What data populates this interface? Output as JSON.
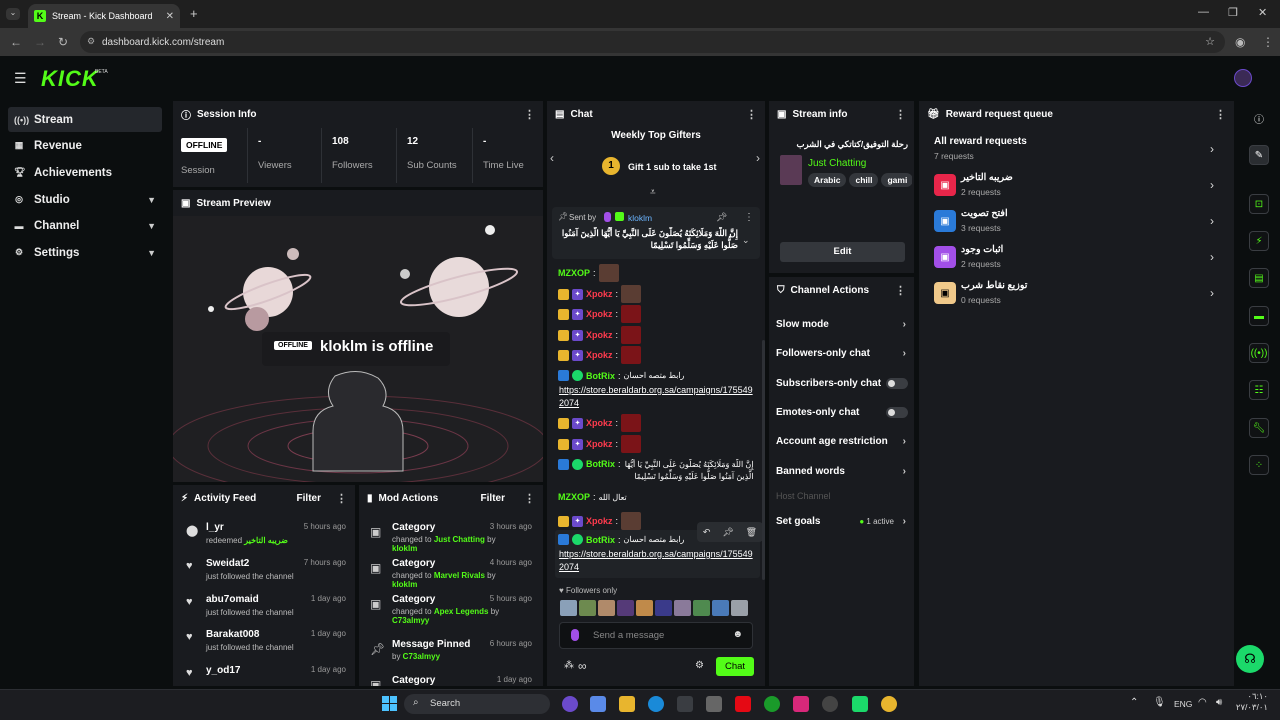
{
  "browser": {
    "tab_title": "Stream - Kick Dashboard",
    "url": "dashboard.kick.com/stream",
    "new_tab": "+"
  },
  "header": {
    "logo": "KICK",
    "beta": "BETA"
  },
  "sidebar": {
    "items": [
      {
        "label": "Stream",
        "icon": "broadcast-icon"
      },
      {
        "label": "Revenue",
        "icon": "revenue-icon"
      },
      {
        "label": "Achievements",
        "icon": "trophy-icon"
      },
      {
        "label": "Studio",
        "icon": "studio-icon"
      },
      {
        "label": "Channel",
        "icon": "channel-icon"
      },
      {
        "label": "Settings",
        "icon": "gear-icon"
      }
    ]
  },
  "session": {
    "title": "Session Info",
    "status": "OFFLINE",
    "status_label": "Session",
    "stats": [
      {
        "value": "-",
        "label": "Viewers"
      },
      {
        "value": "108",
        "label": "Followers"
      },
      {
        "value": "12",
        "label": "Sub Counts"
      },
      {
        "value": "-",
        "label": "Time Live"
      }
    ]
  },
  "preview": {
    "title": "Stream Preview",
    "badge": "OFFLINE",
    "message": "kloklm is offline"
  },
  "activity": {
    "title": "Activity Feed",
    "filter": "Filter",
    "items": [
      {
        "name": "l_yr",
        "desc_prefix": "redeemed ",
        "desc_highlight": "ضريبه التاخير",
        "time": "5 hours ago"
      },
      {
        "name": "Sweidat2",
        "desc_prefix": "just followed the channel",
        "desc_highlight": "",
        "time": "7 hours ago"
      },
      {
        "name": "abu7omaid",
        "desc_prefix": "just followed the channel",
        "desc_highlight": "",
        "time": "1 day ago"
      },
      {
        "name": "Barakat008",
        "desc_prefix": "just followed the channel",
        "desc_highlight": "",
        "time": "1 day ago"
      },
      {
        "name": "y_od17",
        "desc_prefix": "",
        "desc_highlight": "",
        "time": "1 day ago"
      }
    ]
  },
  "mod": {
    "title": "Mod Actions",
    "filter": "Filter",
    "items": [
      {
        "name": "Category",
        "pre": "changed to ",
        "hl1": "Just Chatting",
        "mid": " by ",
        "hl2": "kloklm",
        "time": "3 hours ago"
      },
      {
        "name": "Category",
        "pre": "changed to ",
        "hl1": "Marvel Rivals",
        "mid": " by ",
        "hl2": "kloklm",
        "time": "4 hours ago"
      },
      {
        "name": "Category",
        "pre": "changed to ",
        "hl1": "Apex Legends",
        "mid": " by ",
        "hl2": "C73almyy",
        "time": "5 hours ago"
      },
      {
        "name": "Message Pinned",
        "pre": "by ",
        "hl1": "C73almyy",
        "mid": "",
        "hl2": "",
        "time": "6 hours ago"
      },
      {
        "name": "Category",
        "pre": "",
        "hl1": "",
        "mid": "",
        "hl2": "",
        "time": "1 day ago"
      }
    ]
  },
  "chat": {
    "title": "Chat",
    "gifters_title": "Weekly Top Gifters",
    "gifters_rank": "1",
    "gifters_cta": "Gift 1 sub to take 1st",
    "pinned_sent_by": "Sent by",
    "pinned_user": "kloklm",
    "pinned_text": "إِنَّ اللَّهَ وَمَلَائِكَتَهُ يُصَلُّونَ عَلَى النَّبِيِّ يَا أَيُّهَا الَّذِينَ آمَنُوا صَلُّوا عَلَيْهِ وَسَلِّمُوا تَسْلِيمًا",
    "messages": [
      {
        "user": "MZXOP",
        "text": ""
      },
      {
        "user": "Xpokz",
        "text": ""
      },
      {
        "user": "Xpokz",
        "text": ""
      },
      {
        "user": "Xpokz",
        "text": ""
      },
      {
        "user": "Xpokz",
        "text": ""
      },
      {
        "user": "BotRix",
        "text": "رابط متصه احسان",
        "link": "https://store.beraldarb.org.sa/campaigns/1755492074"
      },
      {
        "user": "Xpokz",
        "text": ""
      },
      {
        "user": "Xpokz",
        "text": ""
      },
      {
        "user": "BotRix",
        "text": "إِنَّ اللَّهَ وَمَلَائِكَتَهُ يُصَلُّونَ عَلَى النَّبِيِّ يَا أَيُّهَا الَّذِينَ آمَنُوا صَلُّوا عَلَيْهِ وَسَلِّمُوا تَسْلِيمًا"
      },
      {
        "user": "MZXOP",
        "text": "تعال الله"
      },
      {
        "user": "Xpokz",
        "text": ""
      },
      {
        "user": "BotRix",
        "text": "رابط متصه احسان",
        "link": "https://store.beraldarb.org.sa/campaigns/1755492074"
      }
    ],
    "followers_only": "Followers only",
    "placeholder": "Send a message",
    "send": "Chat"
  },
  "stream_info": {
    "title": "Stream info",
    "stream_title": "رحلة التوفيق/كتاتكي في الشرب",
    "category": "Just Chatting",
    "tags": [
      "Arabic",
      "chill",
      "gami"
    ],
    "edit": "Edit"
  },
  "channel_actions": {
    "title": "Channel Actions",
    "items": [
      {
        "label": "Slow mode",
        "type": "chevron"
      },
      {
        "label": "Followers-only chat",
        "type": "chevron"
      },
      {
        "label": "Subscribers-only chat",
        "type": "toggle"
      },
      {
        "label": "Emotes-only chat",
        "type": "toggle"
      },
      {
        "label": "Account age restriction",
        "type": "chevron"
      },
      {
        "label": "Banned words",
        "type": "chevron"
      },
      {
        "label": "Host Channel",
        "type": "disabled"
      },
      {
        "label": "Set goals",
        "type": "chevron",
        "extra": "1 active"
      }
    ]
  },
  "reward": {
    "title": "Reward request queue",
    "all_label": "All reward requests",
    "all_count": "7 requests",
    "items": [
      {
        "name": "ضريبه التاخير",
        "count": "2 requests",
        "color": "#e8264a"
      },
      {
        "name": "افتح تصويت",
        "count": "3 requests",
        "color": "#2a7ad8"
      },
      {
        "name": "اثبات وجود",
        "count": "2 requests",
        "color": "#a24fe8"
      },
      {
        "name": "توزيع نقاط شرب",
        "count": "0 requests",
        "color": "#f0c98a"
      }
    ]
  },
  "taskbar": {
    "search": "Search",
    "lang": "ENG",
    "time": "٠٦:١٠",
    "date": "٢٧/٠٣/٠١"
  },
  "colors": {
    "accent": "#53fc18",
    "panel": "#191b1f",
    "bg": "#0b0e0f",
    "danger": "#e8264a"
  }
}
